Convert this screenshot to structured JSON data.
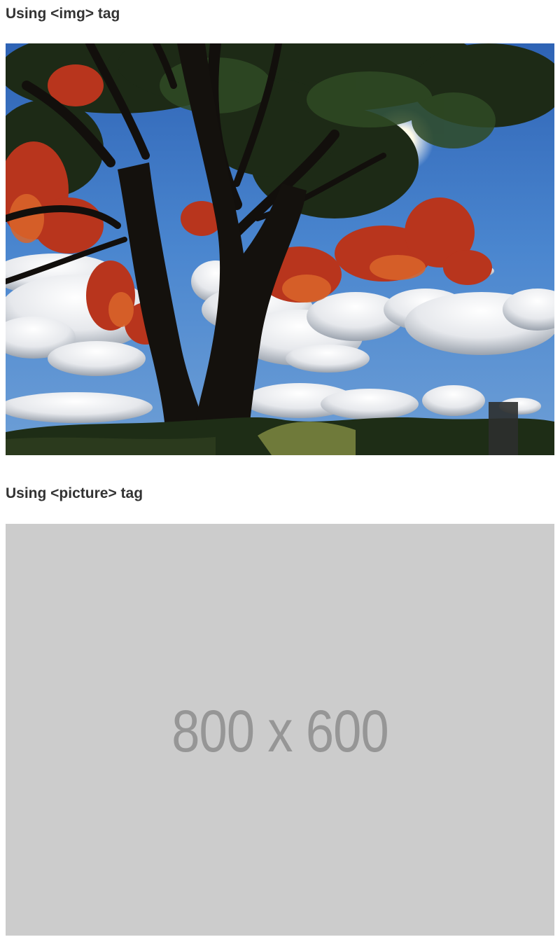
{
  "sections": [
    {
      "heading": "Using <img> tag",
      "image": "tree-landscape-photo"
    },
    {
      "heading": "Using <picture> tag",
      "image": "placeholder-image",
      "placeholder_text": "800 x 600"
    }
  ],
  "colors": {
    "heading_text": "#333333",
    "placeholder_bg": "#cccccc",
    "placeholder_text": "#969696",
    "sky": "#3f78c4"
  }
}
